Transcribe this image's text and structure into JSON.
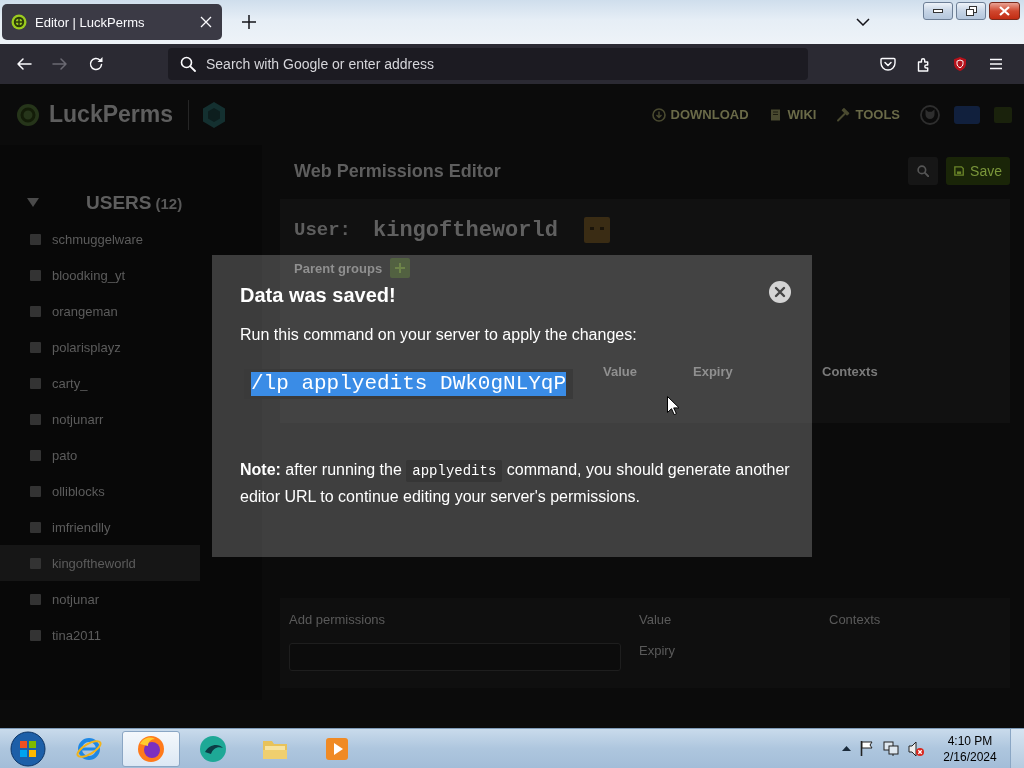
{
  "browser": {
    "tabs": [
      {
        "title": "Editor | LuckPerms",
        "selected": true
      }
    ],
    "toolbar": [
      {
        "kind": "back",
        "disabled": false
      },
      {
        "kind": "forward",
        "disabled": true
      },
      {
        "kind": "reload",
        "disabled": false
      }
    ],
    "address_bar": {
      "placeholder": "Search with Google or enter address"
    }
  },
  "page": {
    "header": {
      "logo": "LuckPerms",
      "nav": [
        {
          "kind": "download",
          "label": "DOWNLOAD"
        },
        {
          "kind": "wiki",
          "label": "WIKI"
        },
        {
          "kind": "tools",
          "label": "TOOLS"
        }
      ]
    },
    "sidebar": {
      "section": {
        "title": "USERS",
        "count": "(12)",
        "expanded": true
      },
      "users": [
        {
          "name": "schmuggelware",
          "selected": false
        },
        {
          "name": "bloodking_yt",
          "selected": false
        },
        {
          "name": "orangeman",
          "selected": false
        },
        {
          "name": "polarisplayz",
          "selected": false
        },
        {
          "name": "carty_",
          "selected": false
        },
        {
          "name": "notjunarr",
          "selected": false
        },
        {
          "name": "pato",
          "selected": false
        },
        {
          "name": "olliblocks",
          "selected": false
        },
        {
          "name": "imfriendlly",
          "selected": false
        },
        {
          "name": "kingoftheworld",
          "selected": true
        },
        {
          "name": "notjunar",
          "selected": false
        },
        {
          "name": "tina2011",
          "selected": false
        }
      ]
    },
    "editor": {
      "title": "Web Permissions Editor",
      "save_button": "Save",
      "user_label": "User:",
      "user_name": "kingoftheworld",
      "parent_groups_label": "Parent groups",
      "columns": [
        "Value",
        "Expiry",
        "Contexts"
      ],
      "add_permissions": {
        "title": "Add permissions",
        "value_label": "Value",
        "contexts_label": "Contexts",
        "expiry_label": "Expiry"
      }
    }
  },
  "modal": {
    "title": "Data was saved!",
    "instruction": "Run this command on your server to apply the changes:",
    "command": "/lp applyedits DWk0gNLYqP",
    "note": {
      "before": "**Note:** after running the",
      "code": "applyedits",
      "after": "command, you should generate another editor URL to continue editing your server's permissions."
    }
  },
  "taskbar": {
    "apps": [
      {
        "kind": "ie",
        "selected": false
      },
      {
        "kind": "firefox",
        "selected": true
      },
      {
        "kind": "teal",
        "selected": false
      },
      {
        "kind": "folder",
        "selected": false
      },
      {
        "kind": "media",
        "selected": false
      }
    ],
    "clock": {
      "time": "4:10 PM",
      "date": "2/16/2024"
    }
  }
}
